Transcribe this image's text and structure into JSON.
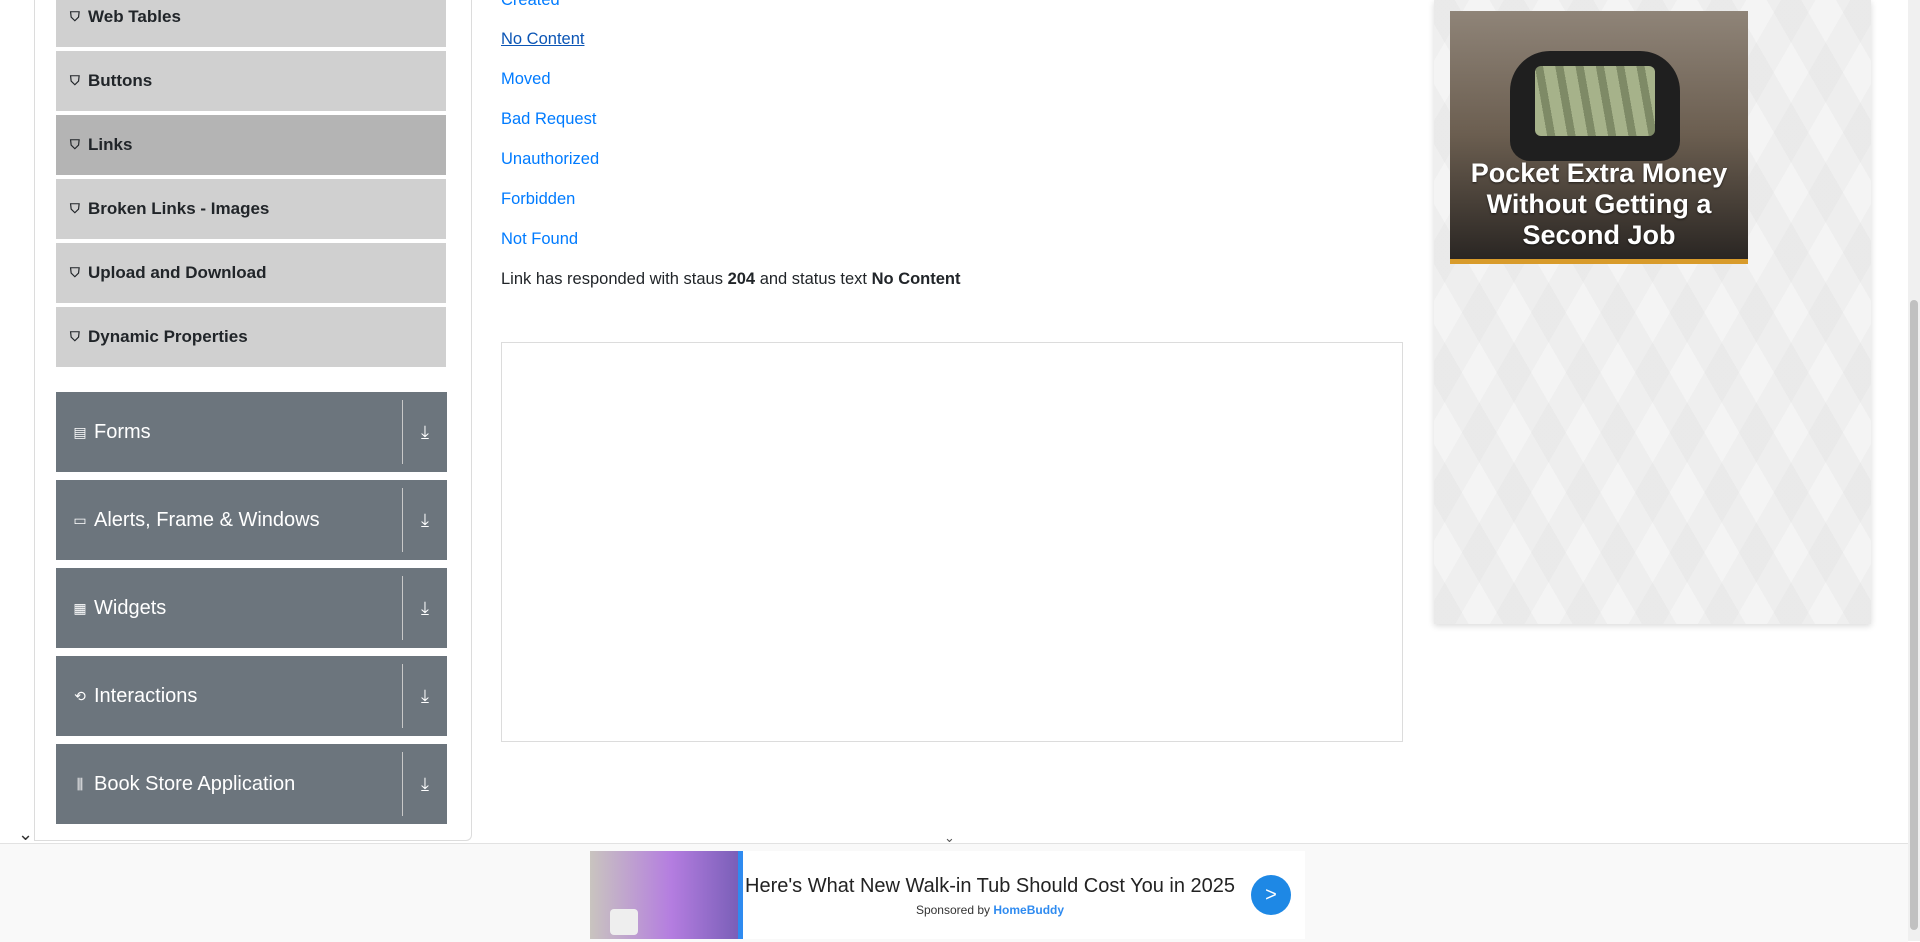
{
  "sidebar": {
    "elements_items": [
      {
        "label": "Web Tables",
        "icon": "badge-icon"
      },
      {
        "label": "Buttons",
        "icon": "badge-icon"
      },
      {
        "label": "Links",
        "icon": "badge-icon",
        "active": true
      },
      {
        "label": "Broken Links - Images",
        "icon": "badge-icon"
      },
      {
        "label": "Upload and Download",
        "icon": "badge-icon"
      },
      {
        "label": "Dynamic Properties",
        "icon": "badge-icon"
      }
    ],
    "groups": [
      {
        "label": "Forms",
        "icon": "form-icon"
      },
      {
        "label": "Alerts, Frame & Windows",
        "icon": "window-icon"
      },
      {
        "label": "Widgets",
        "icon": "widgets-icon"
      },
      {
        "label": "Interactions",
        "icon": "interactions-icon"
      },
      {
        "label": "Book Store Application",
        "icon": "books-icon"
      }
    ]
  },
  "links": {
    "items": [
      "Created",
      "No Content",
      "Moved",
      "Bad Request",
      "Unauthorized",
      "Forbidden",
      "Not Found"
    ]
  },
  "response": {
    "prefix": "Link has responded with staus",
    "code": "204",
    "middle": "and status text",
    "status_text": "No Content"
  },
  "right_ad": {
    "headline": "Pocket Extra Money Without Getting a Second Job"
  },
  "bottom_ad": {
    "headline": "Here's What New Walk-in Tub Should Cost You in 2025",
    "sponsor_prefix": "Sponsored by",
    "sponsor_name": "HomeBuddy",
    "go_label": ">"
  },
  "colors": {
    "link": "#007bff",
    "group_bg": "#6c757d",
    "sub_item_bg": "#d0d0d0",
    "sub_item_active_bg": "#b4b4b4",
    "ad_accent": "#2f8bf0"
  }
}
